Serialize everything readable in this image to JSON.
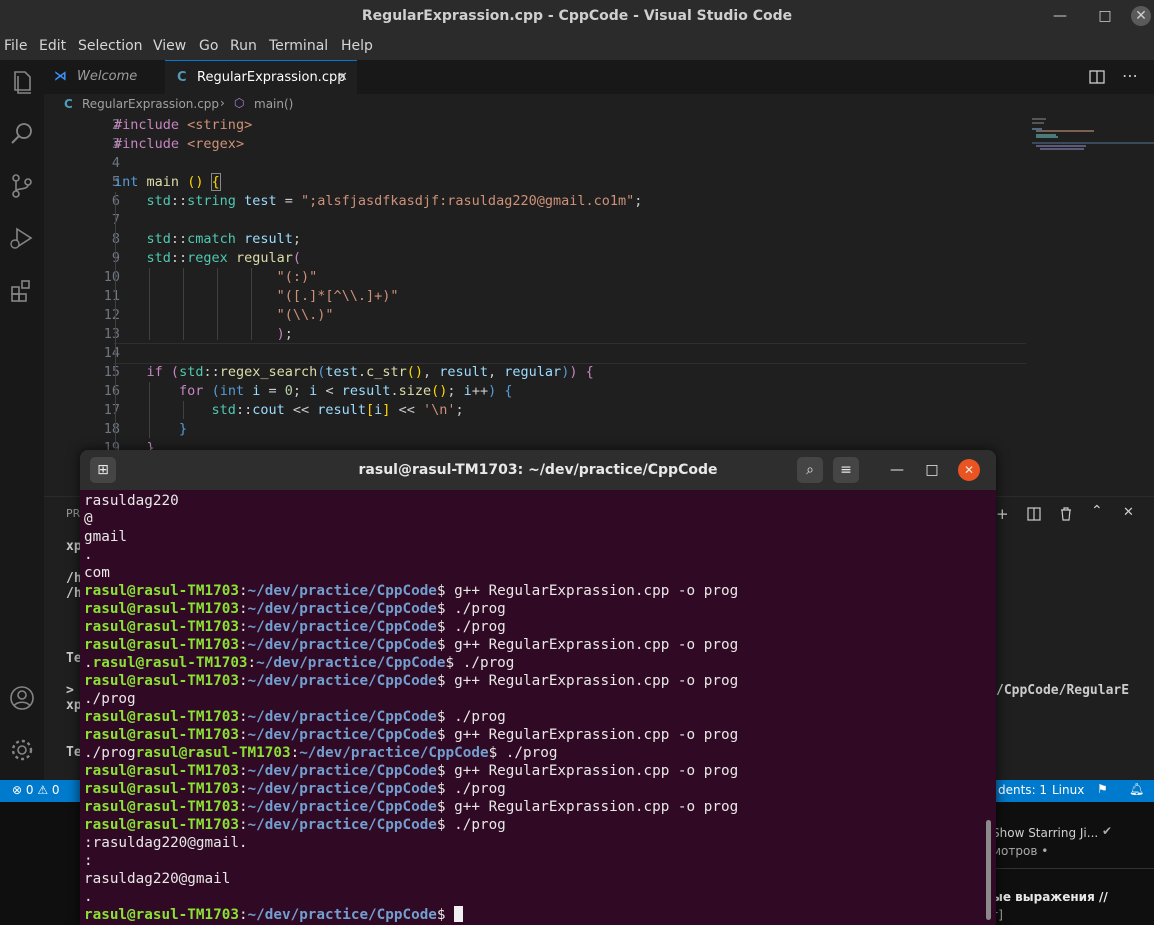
{
  "window": {
    "title": "RegularExprassion.cpp - CppCode - Visual Studio Code"
  },
  "menu": [
    "File",
    "Edit",
    "Selection",
    "View",
    "Go",
    "Run",
    "Terminal",
    "Help"
  ],
  "tabs": [
    {
      "label": "Welcome",
      "active": false
    },
    {
      "label": "RegularExprassion.cpp",
      "active": true
    }
  ],
  "breadcrumb": {
    "file": "RegularExprassion.cpp",
    "symbol": "main()"
  },
  "editor": {
    "line_numbers": [
      "2",
      "3",
      "4",
      "5",
      "6",
      "7",
      "8",
      "9",
      "10",
      "11",
      "12",
      "13",
      "14",
      "15",
      "16",
      "17",
      "18",
      "19",
      "2"
    ]
  },
  "panel": {
    "left_fragments": [
      "PR",
      "xp",
      "/h",
      "/h",
      "Te",
      ">",
      "xp",
      "Te"
    ],
    "right_fragment": "/CppCode/RegularE"
  },
  "statusbar": {
    "problems": "⊗ 0 ⚠ 0",
    "students": "dents: 1",
    "os": "Linux"
  },
  "browser": {
    "line1": "Show Starring Ji...",
    "line2": "мотров •",
    "line3": "ые выражения //",
    "line4": "г]"
  },
  "terminal": {
    "title": "rasul@rasul-TM1703: ~/dev/practice/CppCode",
    "prompt_user": "rasul@rasul-TM1703",
    "prompt_path": "~/dev/practice/CppCode",
    "lines": [
      {
        "type": "out",
        "text": "rasuldag220"
      },
      {
        "type": "out",
        "text": "@"
      },
      {
        "type": "out",
        "text": "gmail"
      },
      {
        "type": "out",
        "text": "."
      },
      {
        "type": "out",
        "text": "com"
      },
      {
        "type": "cmd",
        "pre": "",
        "cmd": " g++ RegularExprassion.cpp -o prog"
      },
      {
        "type": "cmd",
        "pre": "",
        "cmd": " ./prog"
      },
      {
        "type": "cmd",
        "pre": "",
        "cmd": " ./prog"
      },
      {
        "type": "cmd",
        "pre": "",
        "cmd": " g++ RegularExprassion.cpp -o prog"
      },
      {
        "type": "cmd",
        "pre": ".",
        "cmd": " ./prog"
      },
      {
        "type": "cmd",
        "pre": "",
        "cmd": " g++ RegularExprassion.cpp -o prog"
      },
      {
        "type": "out",
        "text": "./prog"
      },
      {
        "type": "cmd",
        "pre": "",
        "cmd": " ./prog"
      },
      {
        "type": "cmd",
        "pre": "",
        "cmd": " g++ RegularExprassion.cpp -o prog"
      },
      {
        "type": "cmd",
        "pre": "./prog",
        "cmd": " ./prog"
      },
      {
        "type": "cmd",
        "pre": "",
        "cmd": " g++ RegularExprassion.cpp -o prog"
      },
      {
        "type": "cmd",
        "pre": "",
        "cmd": " ./prog"
      },
      {
        "type": "cmd",
        "pre": "",
        "cmd": " g++ RegularExprassion.cpp -o prog"
      },
      {
        "type": "cmd",
        "pre": "",
        "cmd": " ./prog"
      },
      {
        "type": "out",
        "text": ":rasuldag220@gmail."
      },
      {
        "type": "out",
        "text": ":"
      },
      {
        "type": "out",
        "text": "rasuldag220@gmail"
      },
      {
        "type": "out",
        "text": "."
      },
      {
        "type": "cmd",
        "pre": "",
        "cmd": " ",
        "cursor": true
      }
    ]
  },
  "colors": {
    "terminal_bg": "#300a24",
    "prompt_user": "#8ae234",
    "prompt_path": "#729fcf",
    "statusbar": "#007acc"
  }
}
